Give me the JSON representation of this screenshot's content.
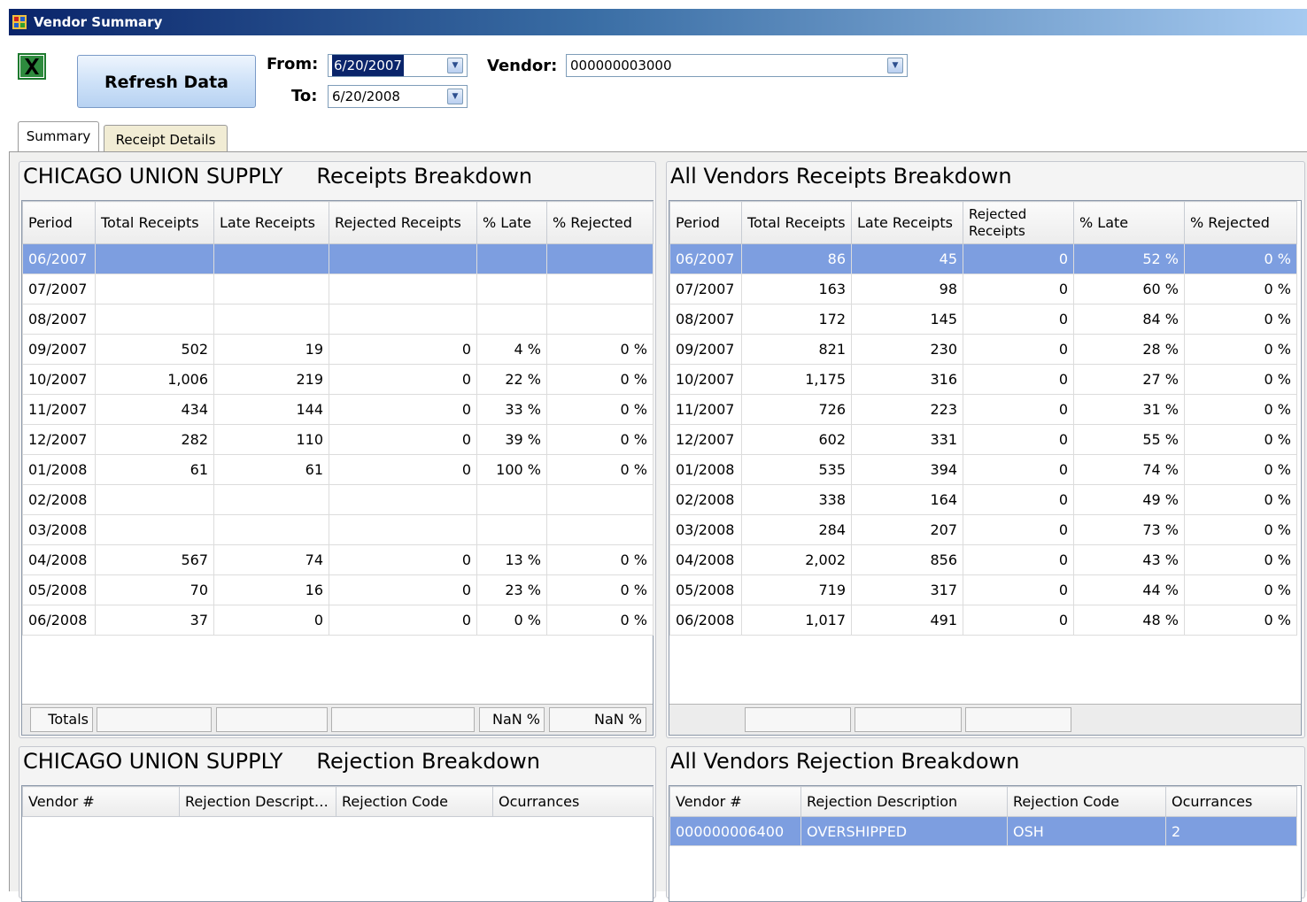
{
  "window": {
    "title": "Vendor Summary"
  },
  "toolbar": {
    "refresh_label": "Refresh Data",
    "from_label": "From:",
    "from_value": "6/20/2007",
    "to_label": "To:",
    "to_value": "6/20/2008",
    "vendor_label": "Vendor:",
    "vendor_value": "000000003000"
  },
  "tabs": [
    {
      "label": "Summary",
      "active": true
    },
    {
      "label": "Receipt Details",
      "active": false
    }
  ],
  "receipts_vendor": {
    "vendor_name": "CHICAGO UNION SUPPLY",
    "section_title": "Receipts Breakdown",
    "columns": [
      "Period",
      "Total Receipts",
      "Late Receipts",
      "Rejected Receipts",
      "% Late",
      "% Rejected"
    ],
    "rows": [
      [
        "06/2007",
        "",
        "",
        "",
        "",
        ""
      ],
      [
        "07/2007",
        "",
        "",
        "",
        "",
        ""
      ],
      [
        "08/2007",
        "",
        "",
        "",
        "",
        ""
      ],
      [
        "09/2007",
        "502",
        "19",
        "0",
        "4 %",
        "0 %"
      ],
      [
        "10/2007",
        "1,006",
        "219",
        "0",
        "22 %",
        "0 %"
      ],
      [
        "11/2007",
        "434",
        "144",
        "0",
        "33 %",
        "0 %"
      ],
      [
        "12/2007",
        "282",
        "110",
        "0",
        "39 %",
        "0 %"
      ],
      [
        "01/2008",
        "61",
        "61",
        "0",
        "100 %",
        "0 %"
      ],
      [
        "02/2008",
        "",
        "",
        "",
        "",
        ""
      ],
      [
        "03/2008",
        "",
        "",
        "",
        "",
        ""
      ],
      [
        "04/2008",
        "567",
        "74",
        "0",
        "13 %",
        "0 %"
      ],
      [
        "05/2008",
        "70",
        "16",
        "0",
        "23 %",
        "0 %"
      ],
      [
        "06/2008",
        "37",
        "0",
        "0",
        "0 %",
        "0 %"
      ]
    ],
    "totals": [
      "Totals",
      "",
      "",
      "",
      "NaN %",
      "NaN %"
    ]
  },
  "receipts_all": {
    "section_title": "All Vendors Receipts Breakdown",
    "columns": [
      "Period",
      "Total Receipts",
      "Late Receipts",
      "Rejected Receipts",
      "% Late",
      "% Rejected"
    ],
    "rows": [
      [
        "06/2007",
        "86",
        "45",
        "0",
        "52 %",
        "0 %"
      ],
      [
        "07/2007",
        "163",
        "98",
        "0",
        "60 %",
        "0 %"
      ],
      [
        "08/2007",
        "172",
        "145",
        "0",
        "84 %",
        "0 %"
      ],
      [
        "09/2007",
        "821",
        "230",
        "0",
        "28 %",
        "0 %"
      ],
      [
        "10/2007",
        "1,175",
        "316",
        "0",
        "27 %",
        "0 %"
      ],
      [
        "11/2007",
        "726",
        "223",
        "0",
        "31 %",
        "0 %"
      ],
      [
        "12/2007",
        "602",
        "331",
        "0",
        "55 %",
        "0 %"
      ],
      [
        "01/2008",
        "535",
        "394",
        "0",
        "74 %",
        "0 %"
      ],
      [
        "02/2008",
        "338",
        "164",
        "0",
        "49 %",
        "0 %"
      ],
      [
        "03/2008",
        "284",
        "207",
        "0",
        "73 %",
        "0 %"
      ],
      [
        "04/2008",
        "2,002",
        "856",
        "0",
        "43 %",
        "0 %"
      ],
      [
        "05/2008",
        "719",
        "317",
        "0",
        "44 %",
        "0 %"
      ],
      [
        "06/2008",
        "1,017",
        "491",
        "0",
        "48 %",
        "0 %"
      ]
    ]
  },
  "rejection_vendor": {
    "vendor_name": "CHICAGO UNION SUPPLY",
    "section_title": "Rejection Breakdown",
    "columns": [
      "Vendor #",
      "Rejection Descript…",
      "Rejection Code",
      "Ocurrances"
    ],
    "rows": []
  },
  "rejection_all": {
    "section_title": "All Vendors Rejection Breakdown",
    "columns": [
      "Vendor #",
      "Rejection Description",
      "Rejection Code",
      "Ocurrances"
    ],
    "rows": [
      [
        "000000006400",
        "OVERSHIPPED",
        "OSH",
        "2"
      ]
    ]
  },
  "colors": {
    "selection": "#7d9ee0",
    "title_gradient_start": "#0a246a",
    "excel_green": "#1d7a2e"
  }
}
